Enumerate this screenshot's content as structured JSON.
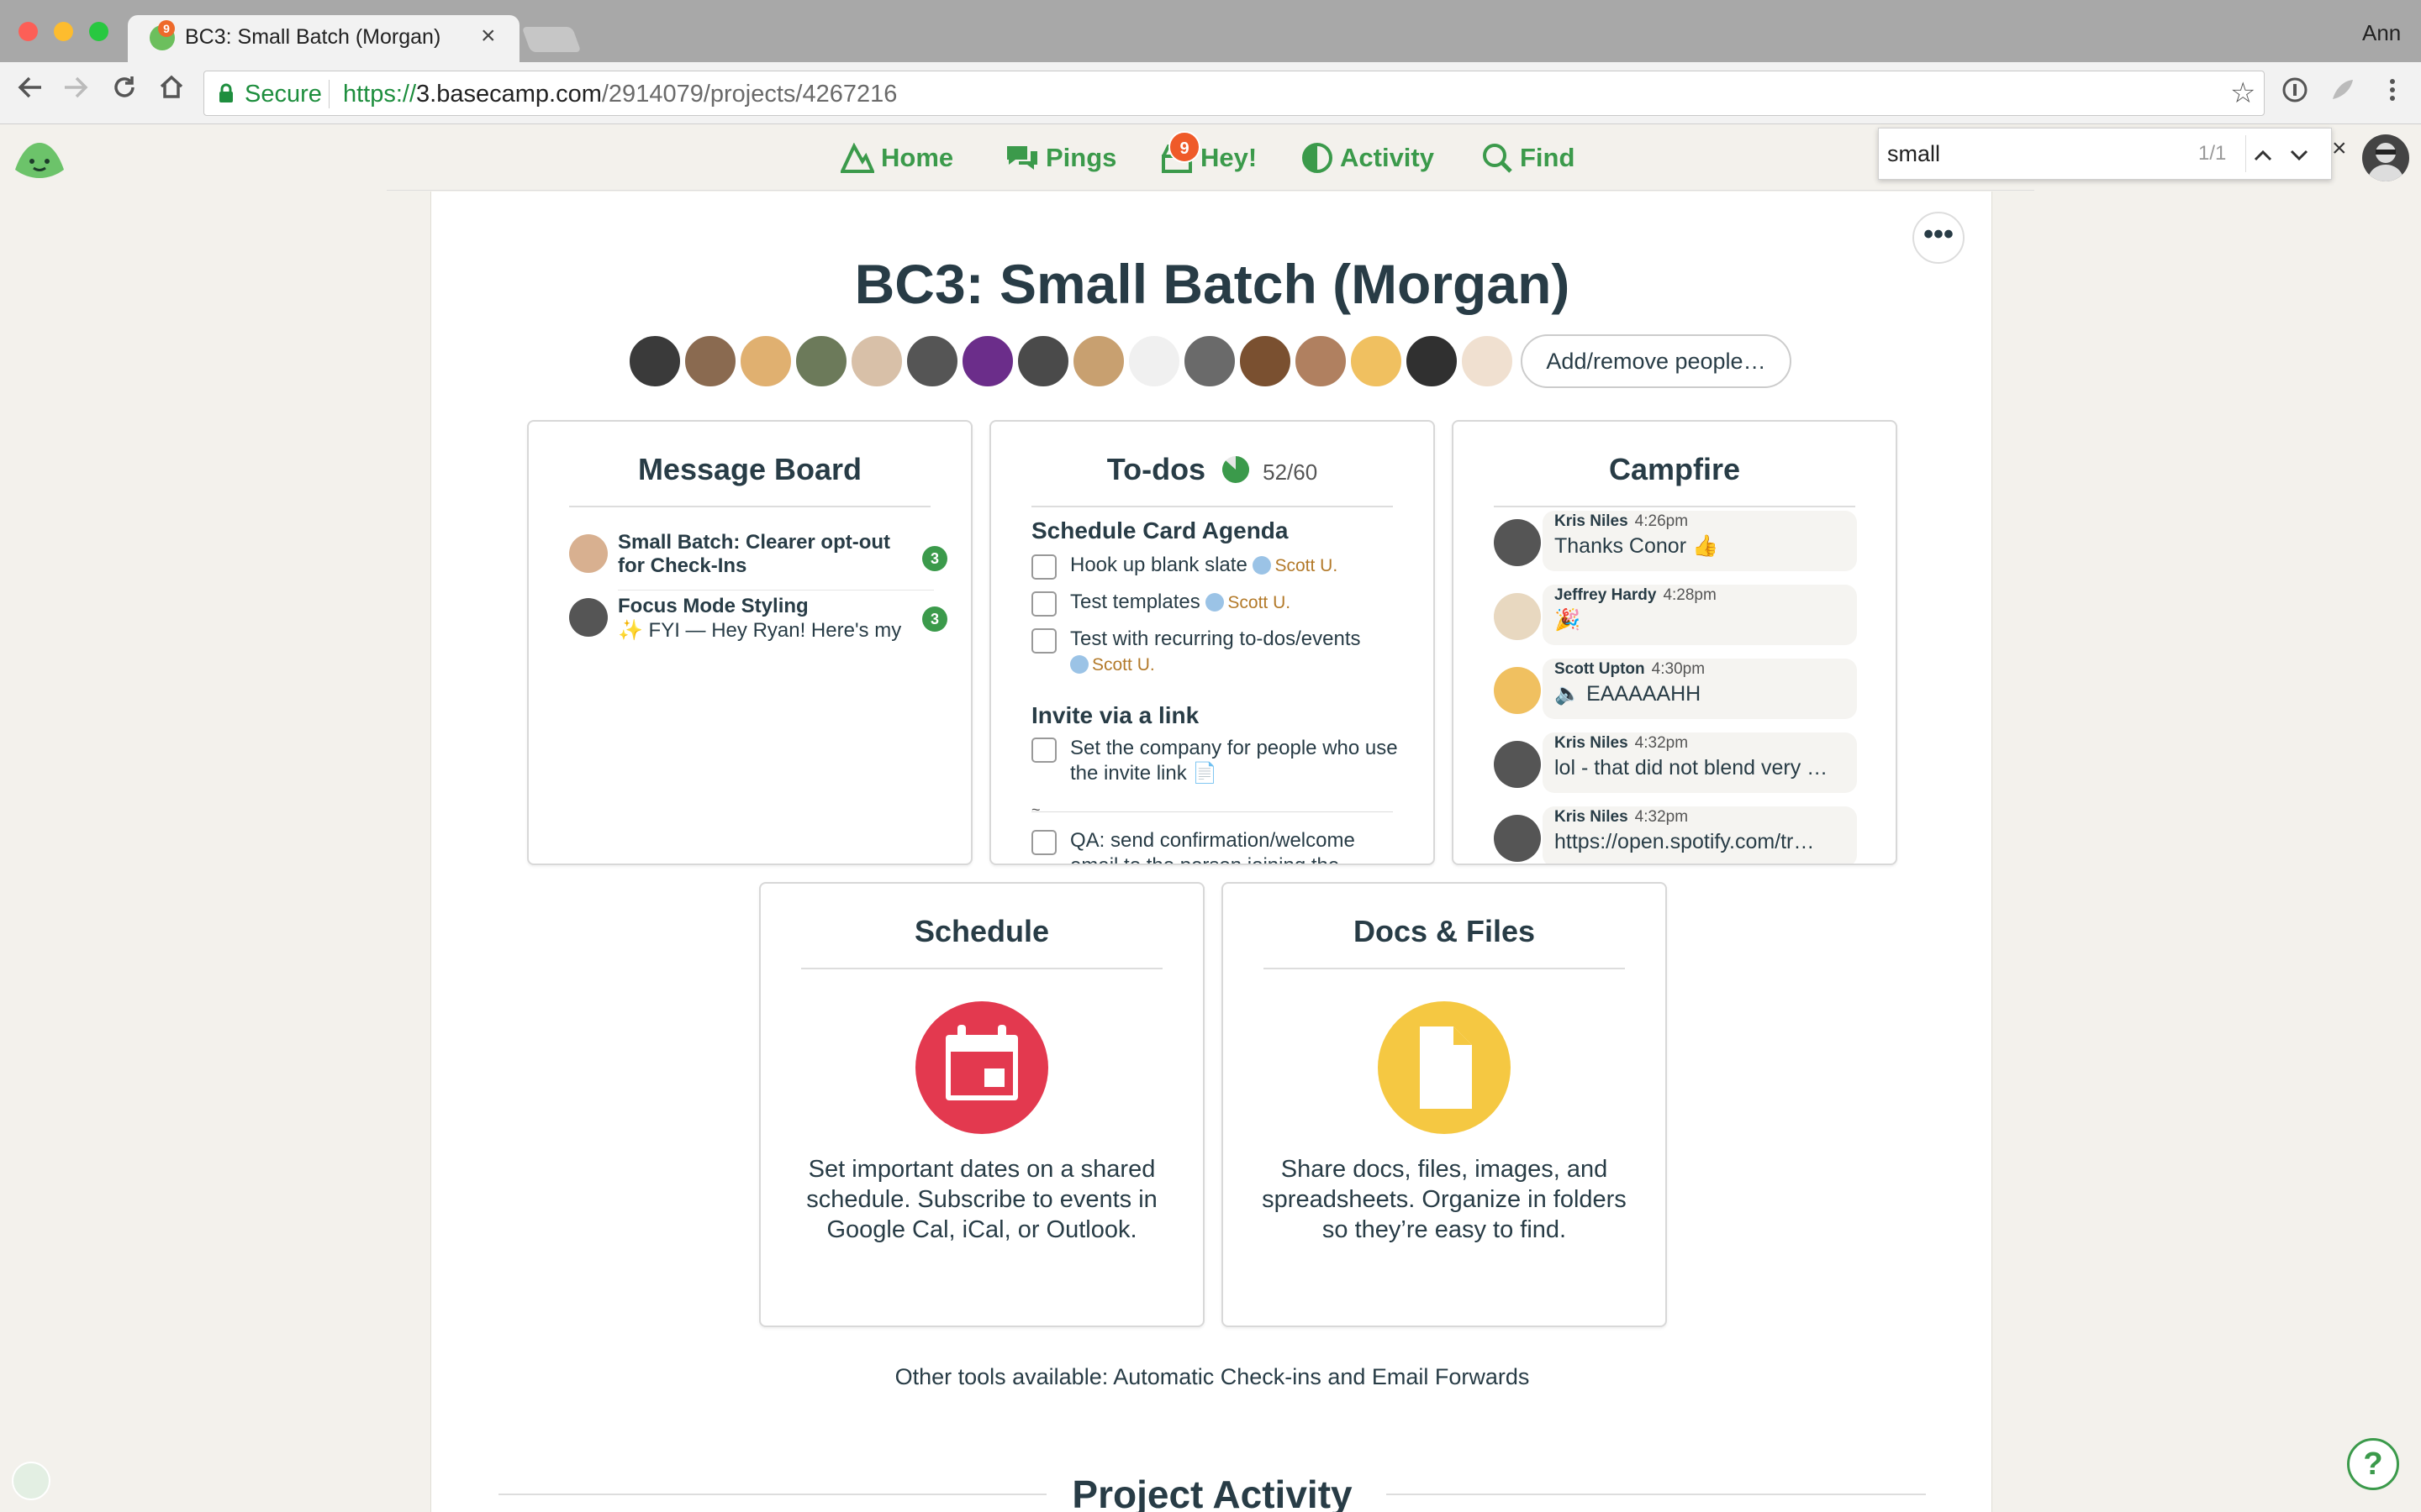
{
  "browser": {
    "tab_title": "BC3: Small Batch (Morgan)",
    "tab_badge": "9",
    "tab_close": "×",
    "user_name": "Ann",
    "secure_label": "Secure",
    "url_scheme": "https://",
    "url_host": "3.basecamp.com",
    "url_path": "/2914079/projects/4267216",
    "find": {
      "query": "small",
      "count": "1/1",
      "close": "×"
    }
  },
  "nav": {
    "home": "Home",
    "pings": "Pings",
    "hey": "Hey!",
    "hey_badge": "9",
    "activity": "Activity",
    "find": "Find"
  },
  "project": {
    "more_label": "•••",
    "title": "BC3: Small Batch (Morgan)",
    "add_people": "Add/remove people…",
    "avatar_colors": [
      "#3a3a3a",
      "#8a6a50",
      "#e0b070",
      "#6c7a5a",
      "#d8c0a8",
      "#555555",
      "#6b2d8a",
      "#4a4a4a",
      "#c8a070",
      "#f0f0f0",
      "#6a6a6a",
      "#7a5030",
      "#b08060",
      "#f0c060",
      "#303030",
      "#f0e0d0"
    ]
  },
  "message_board": {
    "title": "Message Board",
    "items": [
      {
        "title": "Small Batch: Clearer opt-out for Check-Ins",
        "excerpt": "",
        "count": "3"
      },
      {
        "title": "Focus Mode Styling",
        "excerpt": "✨ FYI — Hey Ryan! Here's my",
        "count": "3"
      }
    ]
  },
  "todos": {
    "title": "To-dos",
    "progress": "52/60",
    "progress_fraction": 0.8667,
    "lists": [
      {
        "name": "Schedule Card Agenda"
      },
      {
        "name": "Invite via a link"
      }
    ],
    "items": [
      {
        "text": "Hook up blank slate",
        "assignee": "Scott U."
      },
      {
        "text": "Test templates",
        "assignee": "Scott U."
      },
      {
        "text": "Test with recurring to-dos/events",
        "assignee": "Scott U."
      },
      {
        "text": "Set the company for people who use the invite link 📄",
        "assignee": ""
      },
      {
        "text": "QA: send confirmation/welcome email to the person joining the",
        "assignee": ""
      }
    ],
    "separator_mark": "~"
  },
  "campfire": {
    "title": "Campfire",
    "messages": [
      {
        "name": "Kris Niles",
        "time": "4:26pm",
        "text": "Thanks Conor 👍"
      },
      {
        "name": "Jeffrey Hardy",
        "time": "4:28pm",
        "text": "🎉"
      },
      {
        "name": "Scott Upton",
        "time": "4:30pm",
        "text": "🔈 EAAAAAHH"
      },
      {
        "name": "Kris Niles",
        "time": "4:32pm",
        "text": "lol - that did not blend very …"
      },
      {
        "name": "Kris Niles",
        "time": "4:32pm",
        "text": "https://open.spotify.com/tr…"
      }
    ]
  },
  "schedule": {
    "title": "Schedule",
    "description": "Set important dates on a shared schedule. Subscribe to events in Google Cal, iCal, or Outlook.",
    "icon_color": "#e3394f"
  },
  "docs": {
    "title": "Docs & Files",
    "description": "Share docs, files, images, and spreadsheets. Organize in folders so they’re easy to find.",
    "icon_color": "#f5c842"
  },
  "footer": {
    "other_tools": "Other tools available: Automatic Check-ins and Email Forwards",
    "activity_heading": "Project Activity",
    "help": "?"
  },
  "colors": {
    "brand_green": "#3b9a4b",
    "badge_orange": "#ef5a29",
    "text": "#283c46"
  }
}
